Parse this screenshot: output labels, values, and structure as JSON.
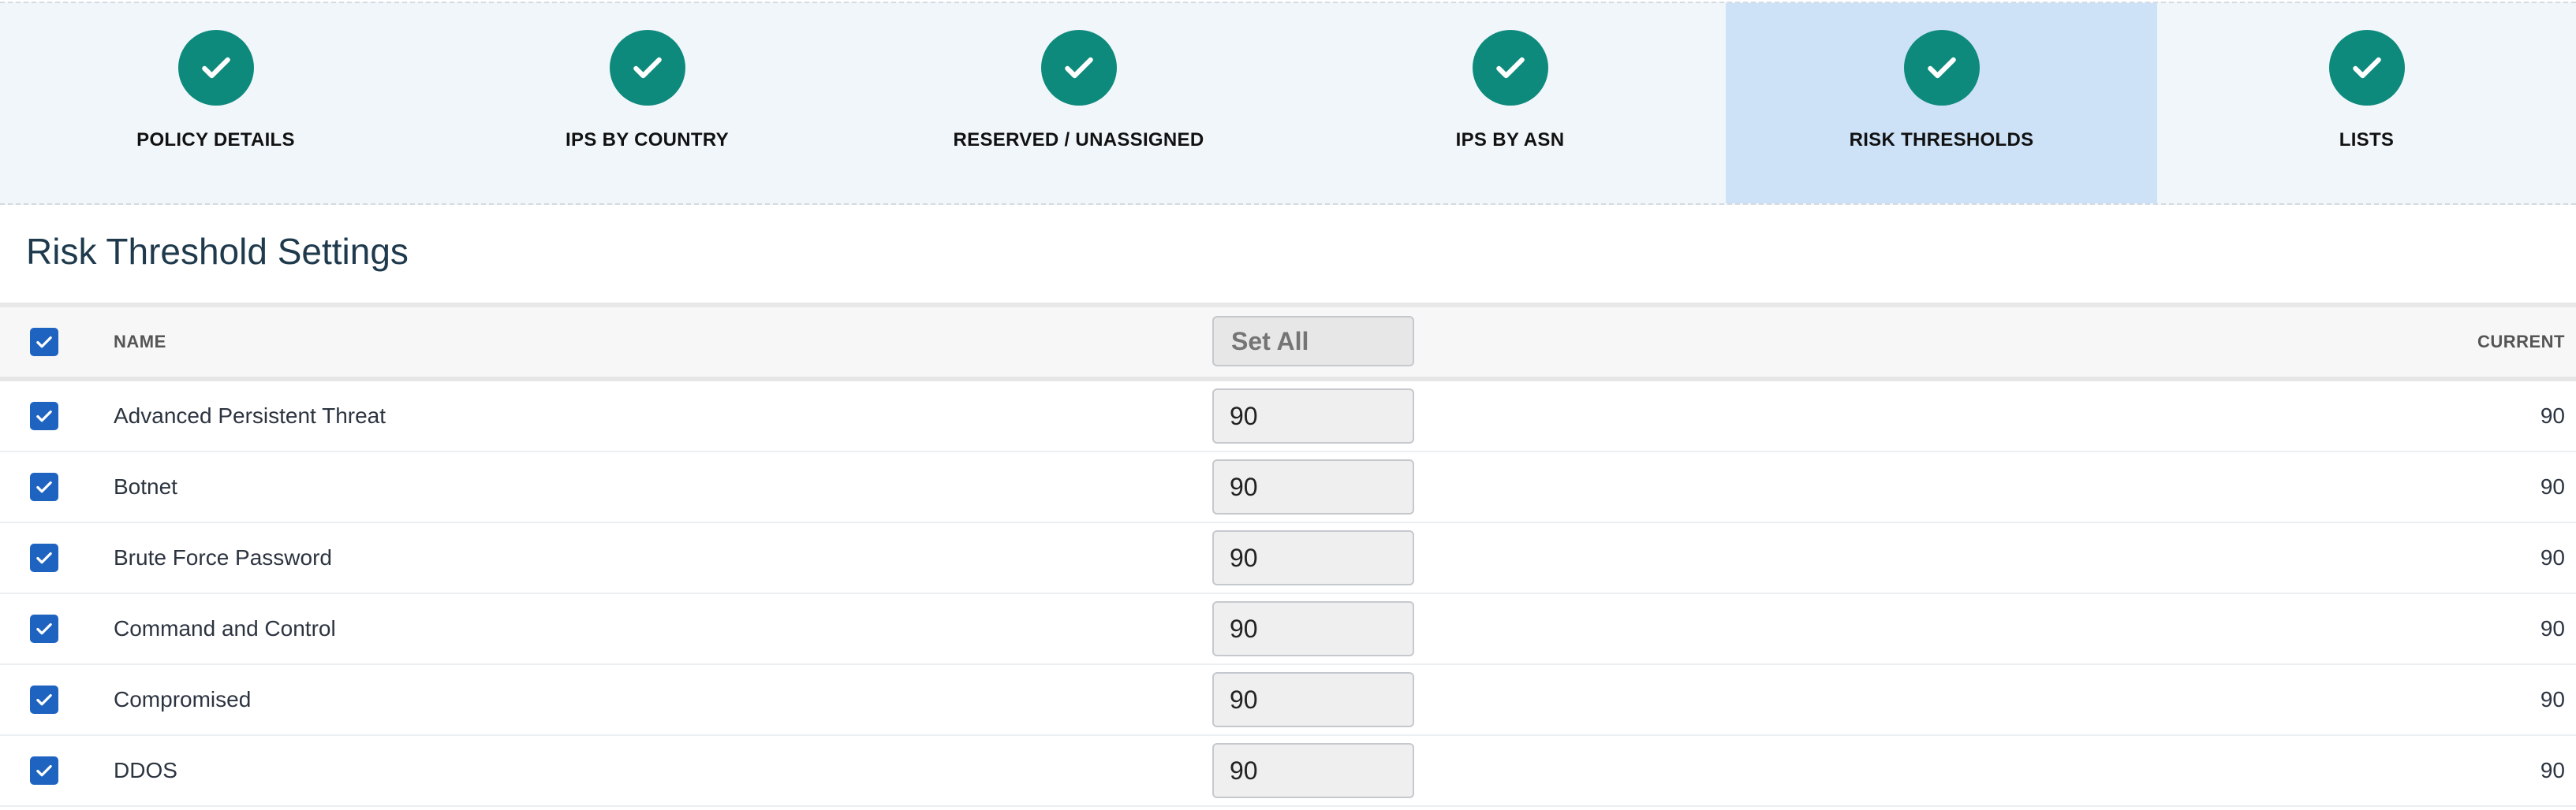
{
  "stepper": {
    "steps": [
      {
        "label": "POLICY DETAILS",
        "complete": true,
        "active": false
      },
      {
        "label": "IPS BY COUNTRY",
        "complete": true,
        "active": false
      },
      {
        "label": "RESERVED / UNASSIGNED",
        "complete": true,
        "active": false
      },
      {
        "label": "IPS BY ASN",
        "complete": true,
        "active": false
      },
      {
        "label": "RISK THRESHOLDS",
        "complete": true,
        "active": true
      },
      {
        "label": "LISTS",
        "complete": true,
        "active": false
      }
    ],
    "colors": {
      "complete": "#0e8a7c",
      "active_bg": "#cde1f7",
      "bg": "#f1f6fb"
    }
  },
  "page": {
    "title": "Risk Threshold Settings"
  },
  "table": {
    "header": {
      "name": "NAME",
      "set_all_placeholder": "Set All",
      "current": "CURRENT",
      "select_all_checked": true
    },
    "rows": [
      {
        "name": "Advanced Persistent Threat",
        "value": "90",
        "current": "90",
        "checked": true
      },
      {
        "name": "Botnet",
        "value": "90",
        "current": "90",
        "checked": true
      },
      {
        "name": "Brute Force Password",
        "value": "90",
        "current": "90",
        "checked": true
      },
      {
        "name": "Command and Control",
        "value": "90",
        "current": "90",
        "checked": true
      },
      {
        "name": "Compromised",
        "value": "90",
        "current": "90",
        "checked": true
      },
      {
        "name": "DDOS",
        "value": "90",
        "current": "90",
        "checked": true
      }
    ],
    "checkbox_color": "#1f63c0"
  },
  "icons": {
    "step": "checkmark-icon",
    "checkbox": "checkbox-checked-icon"
  }
}
